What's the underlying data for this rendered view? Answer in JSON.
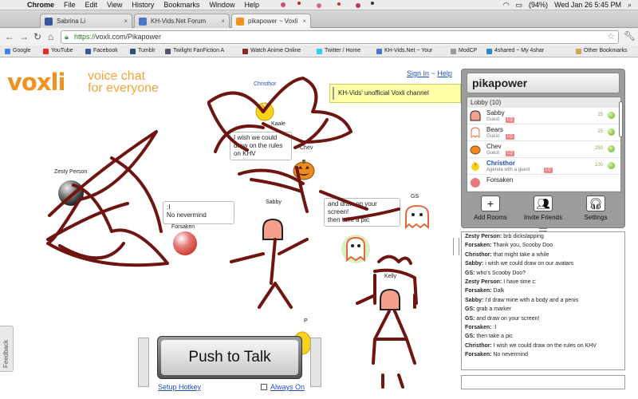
{
  "menubar": {
    "apple": "",
    "menus": [
      "Chrome",
      "File",
      "Edit",
      "View",
      "History",
      "Bookmarks",
      "Window",
      "Help"
    ],
    "battery": "(94%)",
    "clock": "Wed Jan 26  5:45 PM"
  },
  "tabs": [
    {
      "label": "Sabrina Li",
      "color": "#3b5998"
    },
    {
      "label": "KH-Vids.Net Forum",
      "color": "#4a77c9"
    },
    {
      "label": "pikapower ~ Voxli",
      "color": "#f0921f"
    }
  ],
  "address": {
    "scheme": "https://",
    "host": "voxli.com",
    "path": "/Pikapower"
  },
  "bookmarks": [
    {
      "label": "Google",
      "color": "#4285f4"
    },
    {
      "label": "YouTube",
      "color": "#e52d27"
    },
    {
      "label": "Facebook",
      "color": "#3b5998"
    },
    {
      "label": "Tumblr",
      "color": "#34526f"
    },
    {
      "label": "Twilight FanFiction A",
      "color": "#556"
    },
    {
      "label": "Watch Anime Online",
      "color": "#8a2a2a"
    },
    {
      "label": "Twitter / Home",
      "color": "#33ccff"
    },
    {
      "label": "KH-Vids.Net ~ Your",
      "color": "#4a77c9"
    },
    {
      "label": "ModCP",
      "color": "#999"
    },
    {
      "label": "4shared ~ My 4shar",
      "color": "#2a8acb"
    },
    {
      "label": "Other Bookmarks",
      "color": "#c9a85a"
    }
  ],
  "voxli": {
    "logo": "voxli",
    "tagline_1": "voice chat",
    "tagline_2": "for everyone",
    "sign_in": "Sign In",
    "separator": "~",
    "help": "Help",
    "banner": "KH-Vids' unofficial Voxli channel"
  },
  "stage": {
    "avatars": [
      {
        "name": "Zesty Person"
      },
      {
        "name": "Forsaken"
      },
      {
        "name": "Christhor"
      },
      {
        "name": "Kaale"
      },
      {
        "name": "Chev"
      },
      {
        "name": "Sabby"
      },
      {
        "name": "GS"
      },
      {
        "name": "Kelly"
      },
      {
        "name": "P"
      }
    ],
    "bubbles": {
      "christhor": "I wish we could draw on the rules on KHV",
      "forsaken_1": ":I",
      "forsaken_2": "No nevermind",
      "gs_1": "and draw on your screen!",
      "gs_2": "then take a pic"
    }
  },
  "room": {
    "title": "pikapower",
    "lobby": "Lobby",
    "count": "(10)",
    "users": [
      {
        "name": "Sabby",
        "role": "Guest",
        "badge": "LQ",
        "num": "",
        "avatar": "sabby-avatar-icon"
      },
      {
        "name": "Bears",
        "role": "Guest",
        "badge": "LQ",
        "num": "",
        "avatar": "ghost-avatar-icon"
      },
      {
        "name": "Chev",
        "role": "Guest",
        "badge": "LQ",
        "num": "",
        "avatar": "pumpkin-avatar-icon"
      },
      {
        "name": "Christhor",
        "role": "Agenda with a guest",
        "badge": "LQ",
        "num": "",
        "avatar": "candy-avatar-icon"
      },
      {
        "name": "Forsaken",
        "role": "",
        "badge": "",
        "num": "",
        "avatar": "orb-avatar-icon"
      }
    ],
    "actions": {
      "add": "Add Rooms",
      "invite": "Invite Friends",
      "settings": "Settings"
    }
  },
  "chat": [
    {
      "user": "Zesty Person:",
      "text": " brb dickslapping"
    },
    {
      "user": "Forsaken:",
      "text": " Thank you, Scooby Doo"
    },
    {
      "user": "Christhor:",
      "text": " that might take a while"
    },
    {
      "user": "Sabby:",
      "text": " i wish we could draw on our avatars"
    },
    {
      "user": "GS:",
      "text": " who's Scooby Doo?"
    },
    {
      "user": "Zesty Person:",
      "text": " I have time c:"
    },
    {
      "user": "Forsaken:",
      "text": " Dalk"
    },
    {
      "user": "Sabby:",
      "text": " I'd draw mine with a body and a penis"
    },
    {
      "user": "GS:",
      "text": " grab a marker"
    },
    {
      "user": "GS:",
      "text": " and draw on your screen!"
    },
    {
      "user": "Forsaken:",
      "text": " :I"
    },
    {
      "user": "GS:",
      "text": " then take a pic"
    },
    {
      "user": "Christhor:",
      "text": " I wish we could draw on the rules on KHV"
    },
    {
      "user": "Forsaken:",
      "text": " No nevermind"
    }
  ],
  "ptt": {
    "label": "Push to Talk",
    "setup": "Setup Hotkey",
    "always": "Always On"
  },
  "feedback": "Feedback",
  "colors": {
    "marker": "#6e1512",
    "brand": "#f0921f",
    "link": "#1f4fbf"
  }
}
